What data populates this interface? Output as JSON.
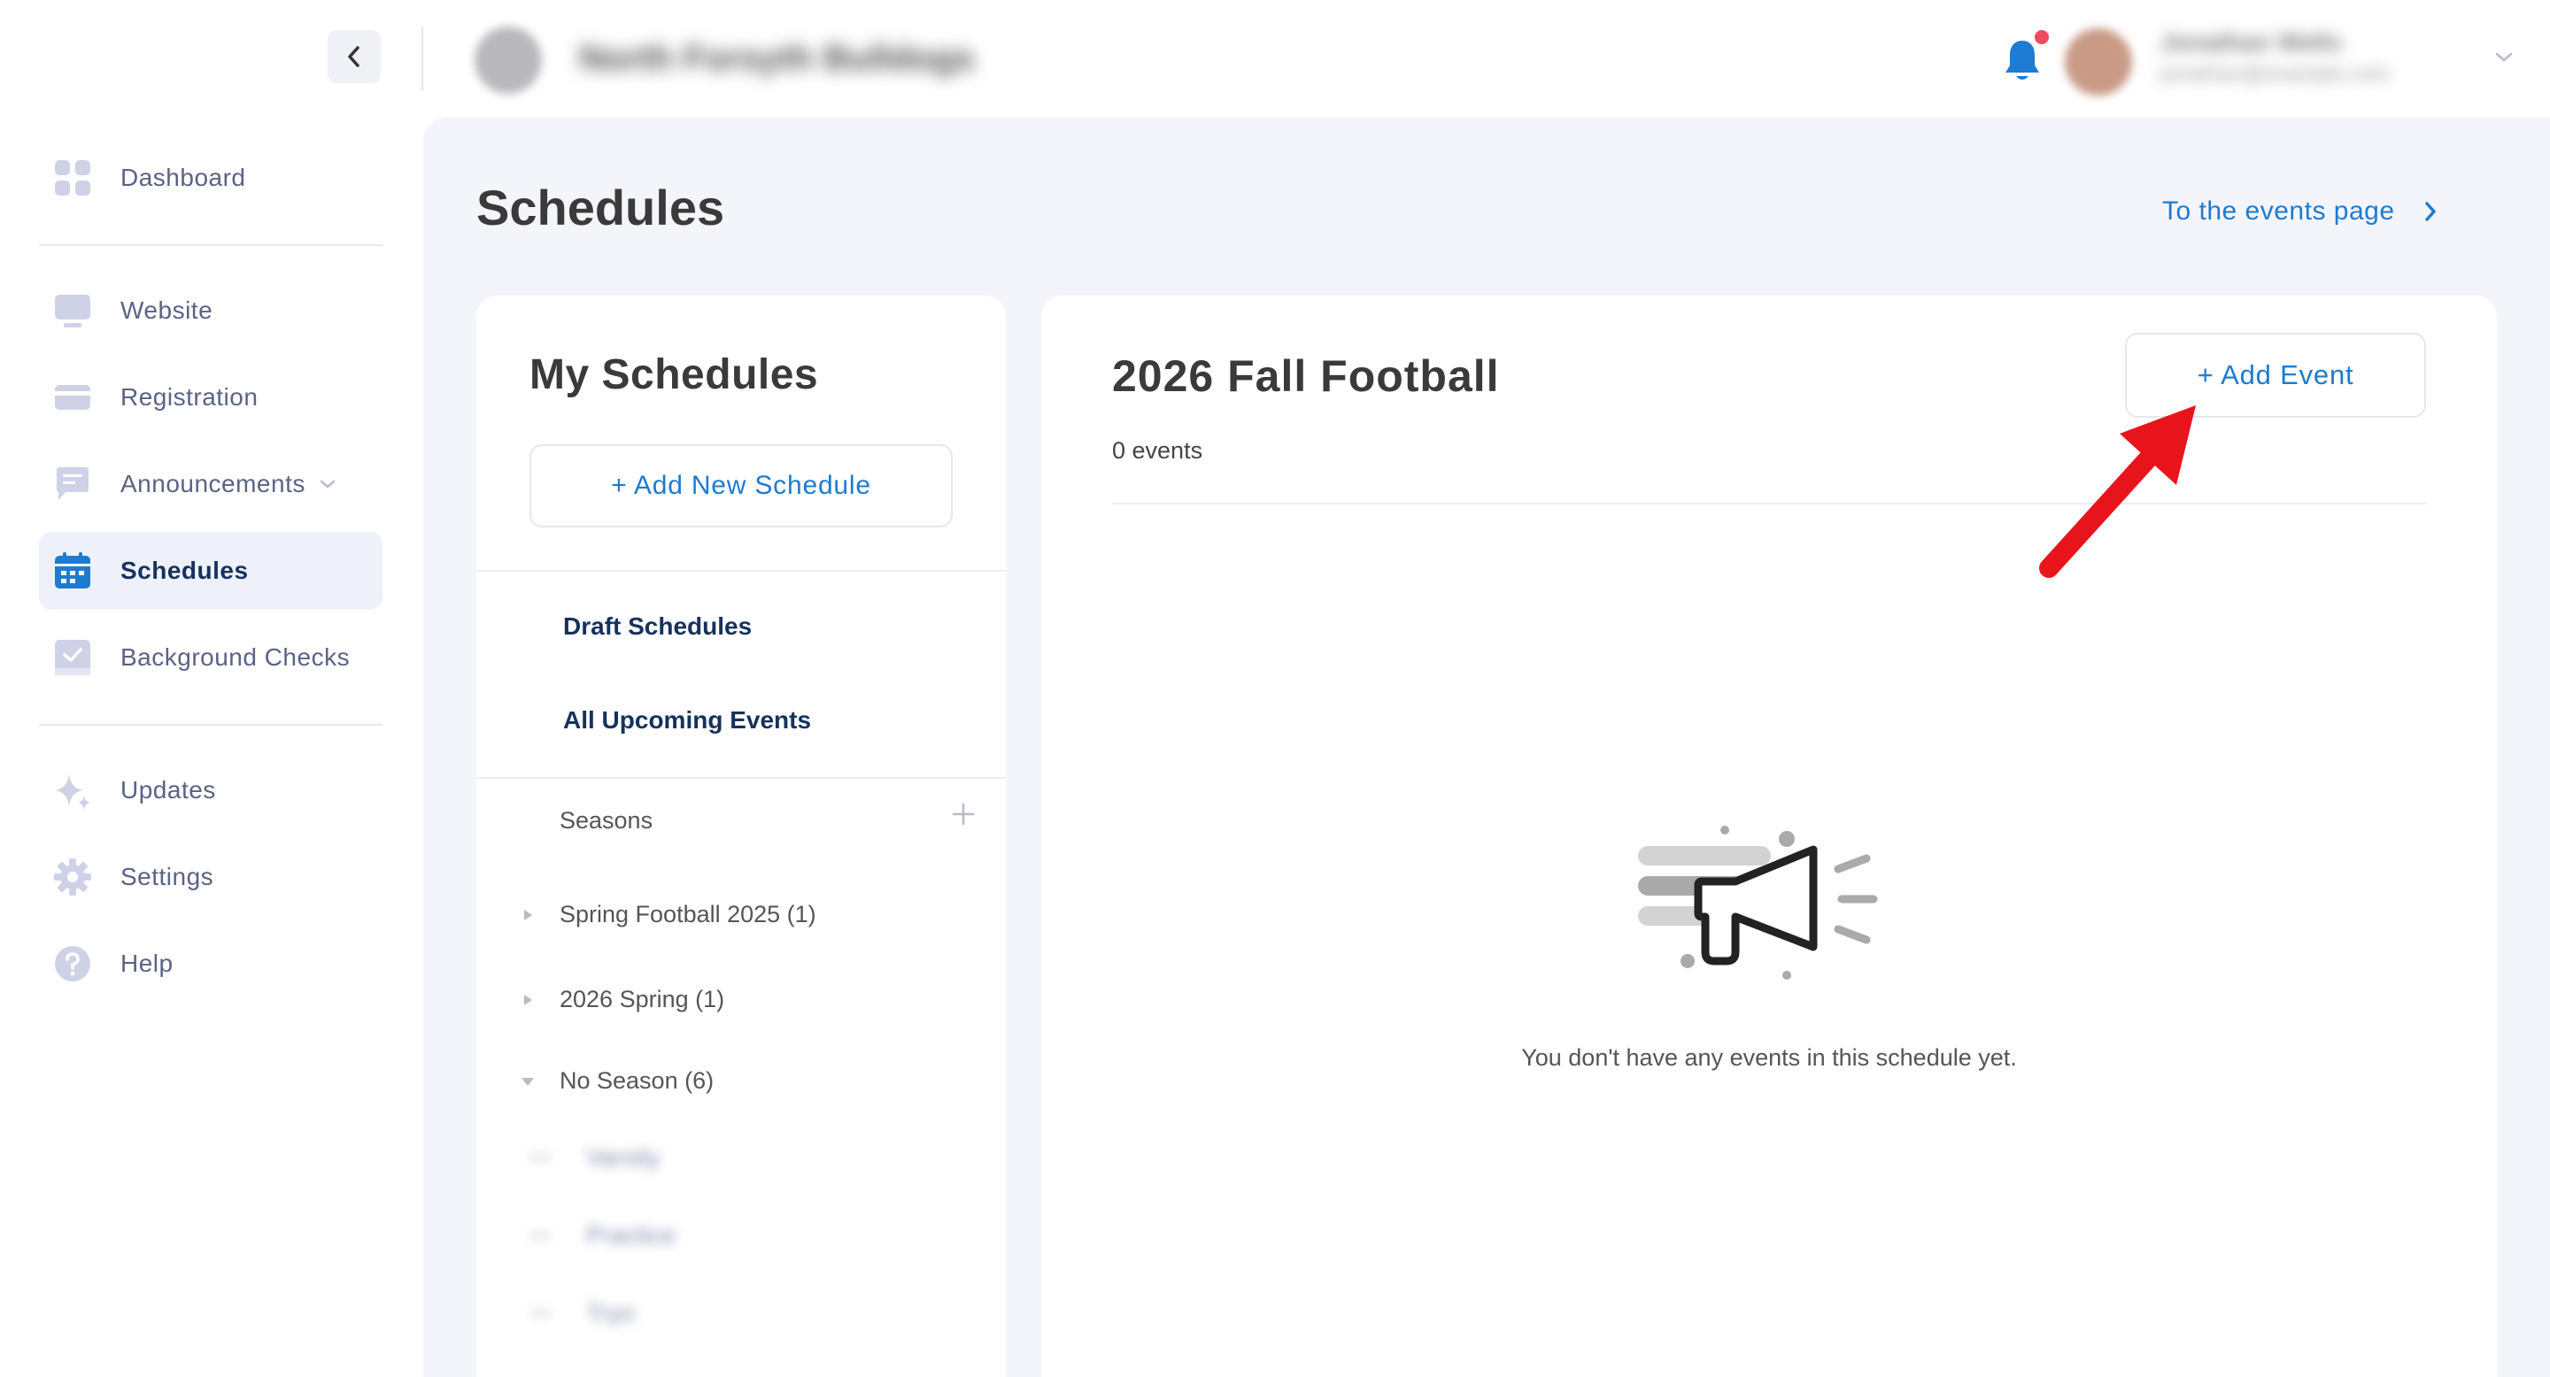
{
  "topbar": {
    "org_name": "North Forsyth Bulldogs",
    "user_name": "Jonathan Wells",
    "user_email": "jonathan@example.com",
    "accent_color": "#1d7bd1",
    "notification_dot_color": "#f04b5a"
  },
  "sidebar": {
    "items": [
      {
        "label": "Dashboard",
        "icon": "dashboard-grid-icon"
      },
      {
        "label": "Website",
        "icon": "monitor-icon"
      },
      {
        "label": "Registration",
        "icon": "credit-card-icon"
      },
      {
        "label": "Announcements",
        "icon": "chat-bubble-icon"
      },
      {
        "label": "Schedules",
        "icon": "calendar-icon",
        "active": true
      },
      {
        "label": "Background Checks",
        "icon": "checkbox-icon"
      },
      {
        "label": "Updates",
        "icon": "sparkle-icon"
      },
      {
        "label": "Settings",
        "icon": "gear-icon"
      },
      {
        "label": "Help",
        "icon": "question-icon"
      }
    ]
  },
  "page": {
    "title": "Schedules",
    "events_link": "To the events page"
  },
  "left_panel": {
    "title": "My Schedules",
    "add_button": "+ Add New Schedule",
    "draft_link": "Draft Schedules",
    "upcoming_link": "All Upcoming Events",
    "seasons_label": "Seasons",
    "seasons": [
      {
        "label": "Spring Football 2025 (1)",
        "expanded": false
      },
      {
        "label": "2026 Spring (1)",
        "expanded": false
      },
      {
        "label": "No Season (6)",
        "expanded": true
      }
    ],
    "blurred_schedules": [
      "Varsity",
      "Practice",
      "Tryo"
    ]
  },
  "right_panel": {
    "title": "2026 Fall Football",
    "event_count": "0 events",
    "add_button": "+ Add Event",
    "empty_message": "You don't have any events in this schedule yet."
  },
  "annotation": {
    "arrow_color": "#e8141c"
  }
}
